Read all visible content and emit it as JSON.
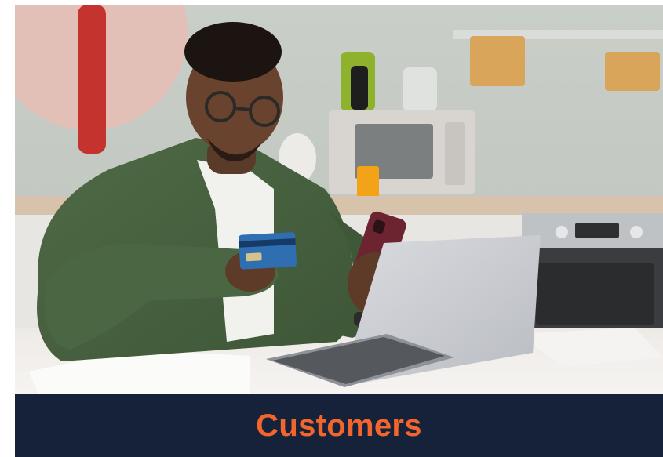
{
  "banner": {
    "title": "Customers"
  },
  "colors": {
    "banner_background": "#16213a",
    "banner_text": "#f2662d"
  },
  "photo": {
    "scene": "man-with-card-phone-laptop-kitchen"
  }
}
